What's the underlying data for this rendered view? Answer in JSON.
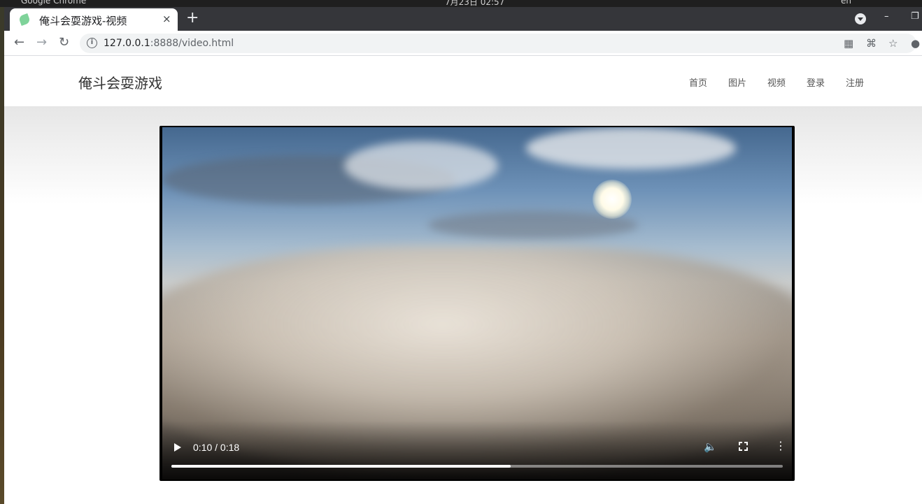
{
  "os": {
    "app_title": "Google Chrome",
    "clock": "7月23日 02:57",
    "lang": "en"
  },
  "browser": {
    "tab_title": "俺斗会耍游戏-视频",
    "tab_close": "×",
    "new_tab": "+",
    "url_host": "127.0.0.1",
    "url_rest": ":8888/video.html",
    "info_glyph": "i"
  },
  "site": {
    "brand": "俺斗会耍游戏",
    "nav": [
      "首页",
      "图片",
      "视频",
      "登录",
      "注册"
    ]
  },
  "video": {
    "current_time": "0:10",
    "duration": "0:18",
    "time_display": "0:10 / 0:18",
    "progress": 0.555
  },
  "colors": {
    "tabstrip": "#35363a",
    "page_bg": "#ffffff",
    "video_bg": "#000000"
  }
}
